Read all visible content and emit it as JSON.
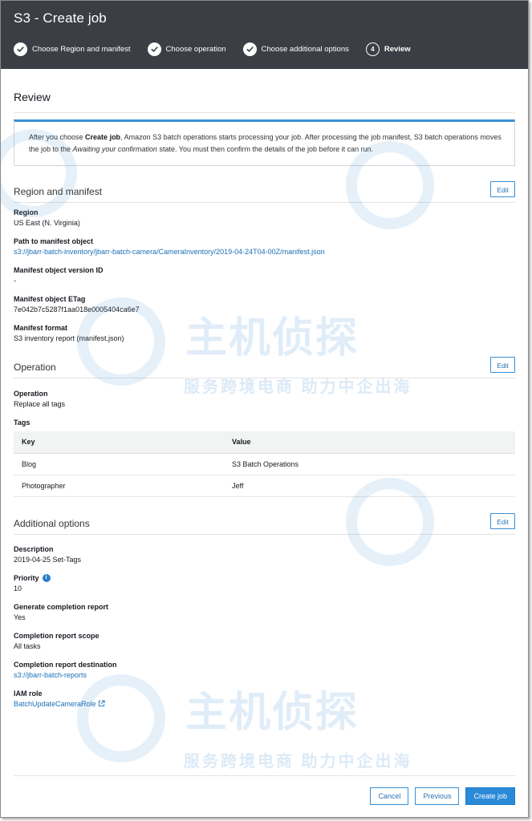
{
  "header": {
    "title": "S3 - Create job",
    "steps": [
      {
        "label": "Choose Region and manifest",
        "state": "done"
      },
      {
        "label": "Choose operation",
        "state": "done"
      },
      {
        "label": "Choose additional options",
        "state": "done"
      },
      {
        "label": "Review",
        "state": "active",
        "number": "4"
      }
    ]
  },
  "page": {
    "title": "Review",
    "info": {
      "part1": "After you choose ",
      "bold": "Create job",
      "part2": ", Amazon S3 batch operations starts processing your job. After processing the job manifest, S3 batch operations moves the job to the ",
      "italic": "Awaiting your confirmation",
      "part3": " state. You must then confirm the details of the job before it can run."
    }
  },
  "region_manifest": {
    "title": "Region and manifest",
    "edit_label": "Edit",
    "fields": [
      {
        "key": "Region",
        "value": "US East (N. Virginia)"
      },
      {
        "key": "Path to manifest object",
        "value": "s3://jbarr-batch-inventory/jbarr-batch-camera/CameraInventory/2019-04-24T04-00Z/manifest.json"
      },
      {
        "key": "Manifest object version ID",
        "value": "-"
      },
      {
        "key": "Manifest object ETag",
        "value": "7e042b7c5287f1aa018e0005404ca6e7"
      },
      {
        "key": "Manifest format",
        "value": "S3 inventory report (manifest.json)"
      }
    ]
  },
  "operation": {
    "title": "Operation",
    "edit_label": "Edit",
    "op_key": "Operation",
    "op_value": "Replace all tags",
    "tags_label": "Tags",
    "table": {
      "headers": [
        "Key",
        "Value"
      ],
      "rows": [
        [
          "Blog",
          "S3 Batch Operations"
        ],
        [
          "Photographer",
          "Jeff"
        ]
      ]
    }
  },
  "additional": {
    "title": "Additional options",
    "edit_label": "Edit",
    "fields": [
      {
        "key": "Description",
        "value": "2019-04-25 Set-Tags"
      },
      {
        "key": "Priority",
        "value": "10",
        "info_icon": "i"
      },
      {
        "key": "Generate completion report",
        "value": "Yes"
      },
      {
        "key": "Completion report scope",
        "value": "All tasks"
      },
      {
        "key": "Completion report destination",
        "value": "s3://jbarr-batch-reports"
      },
      {
        "key": "IAM role",
        "value": "BatchUpdateCameraRole"
      }
    ]
  },
  "footer": {
    "cancel": "Cancel",
    "previous": "Previous",
    "create": "Create job"
  },
  "watermark": {
    "brand": "主机侦探",
    "slogan": "服务跨境电商 助力中企出海"
  },
  "colors": {
    "header_bg": "#3b3f45",
    "accent": "#2a8ad8",
    "link": "#1a6fb5"
  }
}
